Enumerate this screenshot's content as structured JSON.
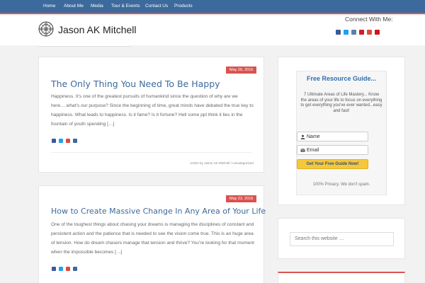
{
  "nav": {
    "items": [
      "Home",
      "About Me",
      "Media",
      "Tour & Events",
      "Contact Us",
      "Products"
    ]
  },
  "header": {
    "site_title": "Jason AK Mitchell",
    "logo_icon": "mandala-logo-icon",
    "connect_label": "Connect With Me:",
    "social_icons": [
      "facebook-icon",
      "twitter-icon",
      "instagram-icon",
      "pinterest-icon",
      "googleplus-icon",
      "youtube-icon"
    ]
  },
  "posts": [
    {
      "date": "May 26, 2016",
      "title": "The Only Thing You Need To Be Happy",
      "excerpt": "Happiness. It’s one of the greatest pursuits of humankind since the question of why are we here….what’s our purpose? Since the beginning of time, great minds have debated the true key to happiness. What leads to happiness. Is it fame? Is it fortune? Hell some ppl think it lies in the fountain of youth spending […]",
      "meta": "Article by Jason AK Mitchell / Uncategorized"
    },
    {
      "date": "May 23, 2016",
      "title": "How to Create Massive Change In Any Area of Your Life",
      "excerpt": "One of the toughest things about chasing your dreams is managing the disciplines of constant and persistent action and the patience that is needed to see the vision come true. This is an huge area of tension. How do dream chasers manage that tension and thrive? You’re looking for that moment when the impossible becomes […]"
    }
  ],
  "sidebar": {
    "optin_title": "Free Resource Guide...",
    "optin_desc": "7 Ultimate Areas of Life Mastery... Know the areas of your life to focus on everything to get everything you've ever wanted...easy and fast!",
    "name_placeholder": "Name",
    "email_placeholder": "Email",
    "cta_label": "Get Your Free Guide Now!",
    "privacy": "100% Privacy. We don't spam.",
    "search_placeholder": "Search this website …"
  },
  "colors": {
    "nav_bg": "#3d6a9c",
    "accent": "#d9534f",
    "link": "#3d6a9c",
    "cta": "#f5c83b"
  }
}
